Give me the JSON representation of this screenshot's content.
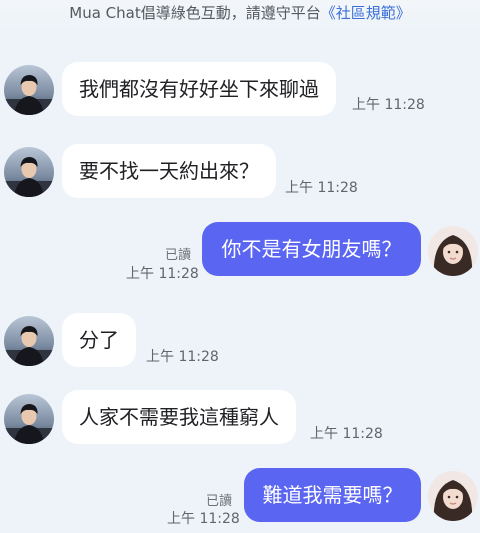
{
  "header": {
    "notice_prefix": "Mua Chat倡導綠色互動，請遵守平台",
    "rules_link": "《社區規範》"
  },
  "messages": [
    {
      "side": "in",
      "text": "我們都沒有好好坐下來聊過",
      "time": "上午 11:28"
    },
    {
      "side": "in",
      "text": "要不找一天約出來？",
      "time": "上午 11:28"
    },
    {
      "side": "out",
      "text": "你不是有女朋友嗎？",
      "time": "上午 11:28",
      "status": "已讀"
    },
    {
      "side": "in",
      "text": "分了",
      "time": "上午 11:28"
    },
    {
      "side": "in",
      "text": "人家不需要我這種窮人",
      "time": "上午 11:28"
    },
    {
      "side": "out",
      "text": "難道我需要嗎？",
      "time": "上午 11:28",
      "status": "已讀"
    }
  ],
  "colors": {
    "background": "#edf3f8",
    "incoming_bubble": "#ffffff",
    "outgoing_bubble": "#5a65f2",
    "link": "#3b6fd9"
  },
  "icons": {
    "incoming_avatar": "male-contact-avatar",
    "outgoing_avatar": "female-user-avatar"
  }
}
